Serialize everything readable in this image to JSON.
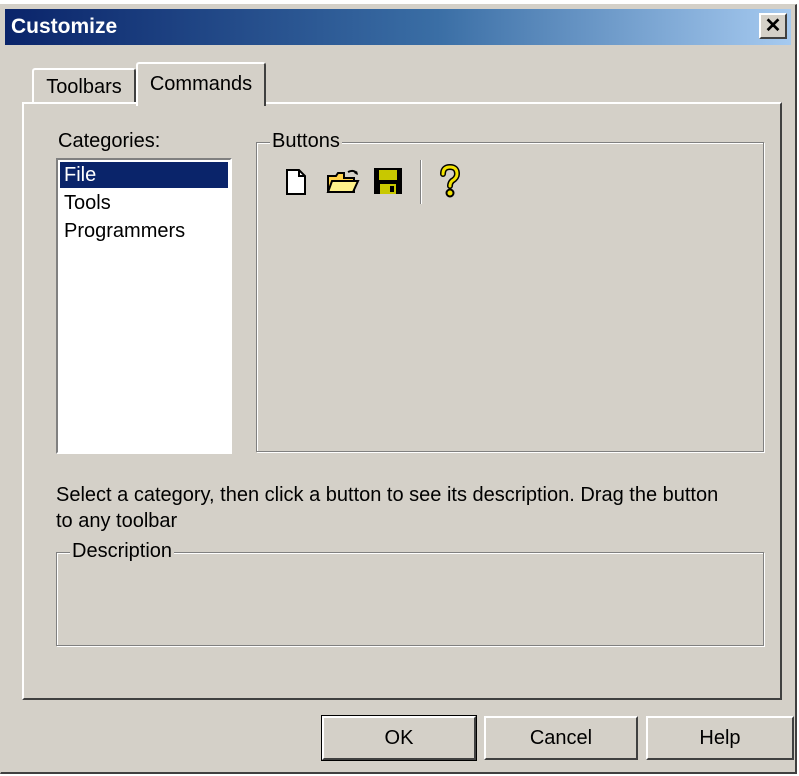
{
  "window": {
    "title": "Customize",
    "close_glyph": "✕"
  },
  "tabs": [
    {
      "label": "Toolbars",
      "active": false
    },
    {
      "label": "Commands",
      "active": true
    }
  ],
  "categories": {
    "label": "Categories:",
    "items": [
      "File",
      "Tools",
      "Programmers"
    ],
    "selected": "File"
  },
  "buttons_group": {
    "legend": "Buttons",
    "icons": [
      "new-document-icon",
      "open-folder-icon",
      "save-icon",
      "help-icon"
    ]
  },
  "instructions": {
    "line1": "Select a category, then click a button to see its description. Drag the button",
    "line2": "to any toolbar"
  },
  "description_group": {
    "legend": "Description"
  },
  "actions": {
    "ok": "OK",
    "cancel": "Cancel",
    "help": "Help"
  },
  "colors": {
    "face": "#d4d0c8",
    "selection": "#0a246a",
    "title_gradient_start": "#0a246a",
    "title_gradient_end": "#a6caf0"
  }
}
